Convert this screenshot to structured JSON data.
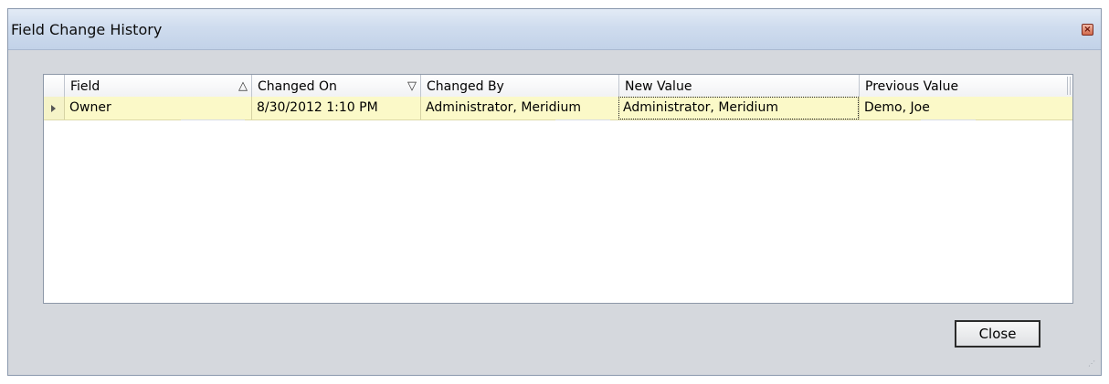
{
  "window": {
    "title": "Field Change History"
  },
  "grid": {
    "columns": [
      {
        "label": "Field",
        "sort_icon": "△"
      },
      {
        "label": "Changed On",
        "sort_icon": "▽"
      },
      {
        "label": "Changed By",
        "sort_icon": ""
      },
      {
        "label": "New Value",
        "sort_icon": ""
      },
      {
        "label": "Previous Value",
        "sort_icon": ""
      }
    ],
    "rows": [
      {
        "field": "Owner",
        "changed_on": "8/30/2012 1:10 PM",
        "changed_by": "Administrator, Meridium",
        "new_value": "Administrator, Meridium",
        "previous_value": "Demo, Joe"
      }
    ]
  },
  "buttons": {
    "close_label": "Close"
  },
  "colors": {
    "selected_row": "#fbf9c8",
    "title_bar": "#cfdcee",
    "dialog_body": "#d5d8dd"
  }
}
